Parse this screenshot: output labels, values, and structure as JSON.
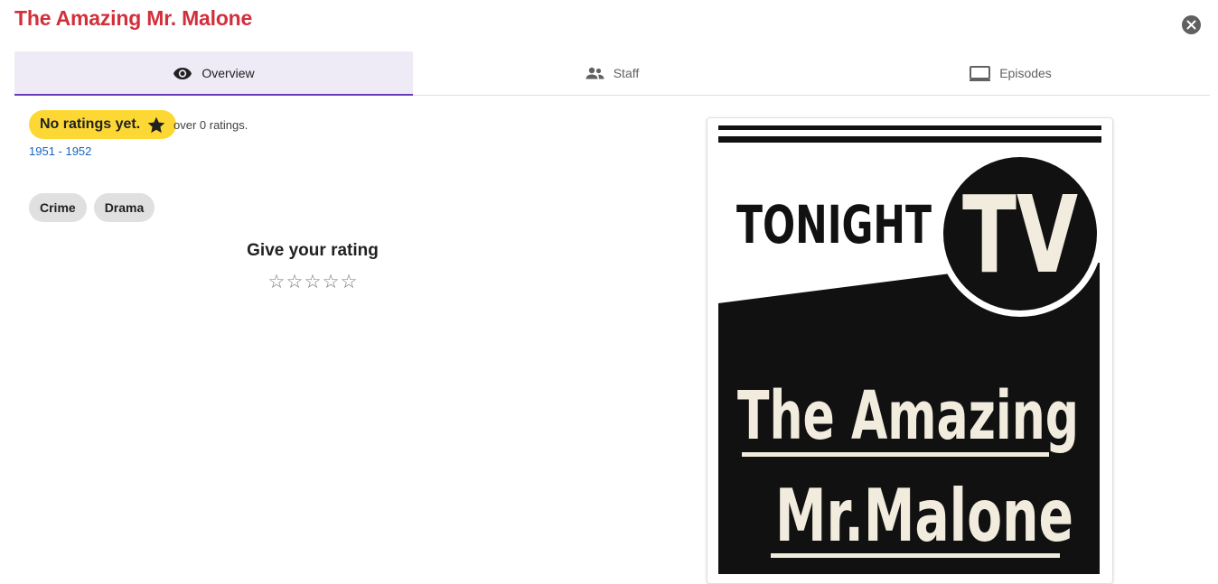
{
  "window": {
    "title": "The Amazing Mr. Malone",
    "close_icon": "close-circle-icon"
  },
  "tabs": [
    {
      "label": "Overview",
      "icon": "eye-icon",
      "active": true
    },
    {
      "label": "Staff",
      "icon": "people-icon",
      "active": false
    },
    {
      "label": "Episodes",
      "icon": "tv-icon",
      "active": false
    }
  ],
  "overview": {
    "rating_label": "No ratings yet.",
    "rating_icon": "star-icon",
    "rating_count_text": "over 0 ratings.",
    "years": "1951 - 1952",
    "genres": [
      "Crime",
      "Drama"
    ],
    "give_rating_heading": "Give your rating",
    "user_rating_stars": 0,
    "user_rating_max": 5
  },
  "poster": {
    "line1": "TONIGHT",
    "line2": "TV",
    "line3": "The Amazing",
    "line4": "Mr.Malone"
  },
  "colors": {
    "title": "#d32f3b",
    "active_tab_bg": "#eeeaf6",
    "active_tab_indicator": "#673ab7",
    "rating_chip": "#fdd835",
    "link": "#1565c0"
  }
}
